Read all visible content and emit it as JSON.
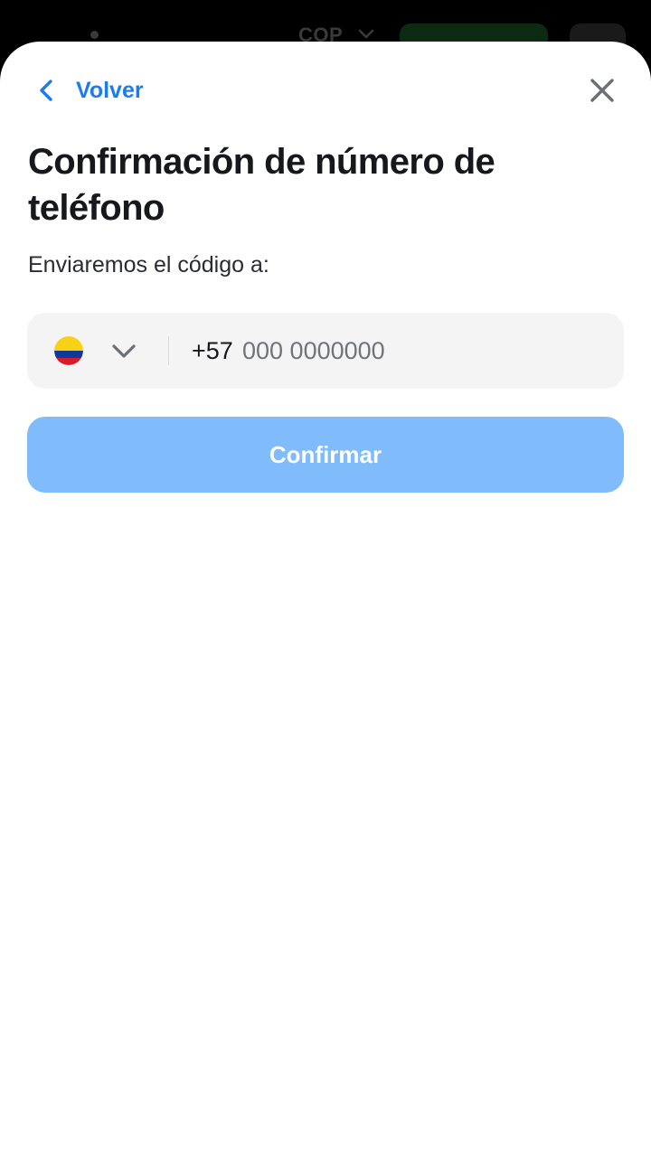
{
  "background": {
    "currency": "COP",
    "currency_chevron_icon": "chevron-down-icon"
  },
  "header": {
    "back_label": "Volver",
    "back_icon": "chevron-left-icon",
    "close_icon": "close-icon"
  },
  "title": "Confirmación de número de teléfono",
  "subtitle": "Enviaremos el código a:",
  "phone": {
    "country_flag_icon": "colombia-flag-icon",
    "country_chevron_icon": "chevron-down-icon",
    "dial_code": "+57",
    "value": "",
    "placeholder": "000 0000000"
  },
  "confirm_button": {
    "label": "Confirmar"
  },
  "colors": {
    "accent": "#1a7cf0",
    "button_disabled": "#80bcfb",
    "field_bg": "#f4f4f5",
    "title_text": "#16181c"
  }
}
